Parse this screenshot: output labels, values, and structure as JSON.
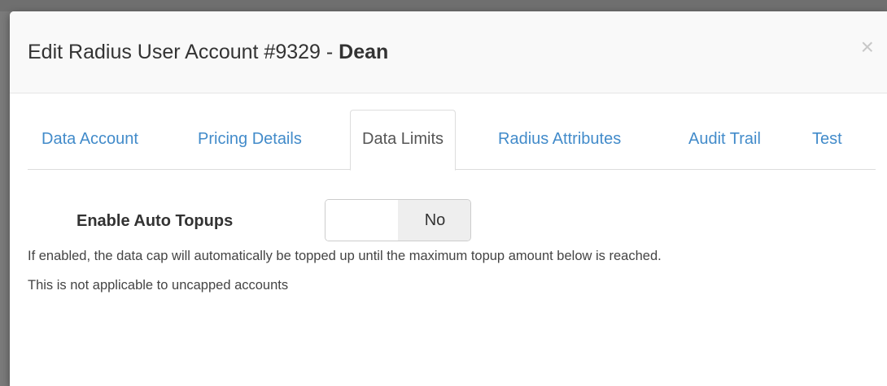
{
  "modal": {
    "title_prefix": "Edit Radius User Account #9329 - ",
    "title_name": "Dean",
    "close_glyph": "×"
  },
  "tabs": [
    {
      "label": "Data Account",
      "active": false
    },
    {
      "label": "Pricing Details",
      "active": false
    },
    {
      "label": "Data Limits",
      "active": true
    },
    {
      "label": "Radius Attributes",
      "active": false
    },
    {
      "label": "Audit Trail",
      "active": false
    },
    {
      "label": "Test",
      "active": false
    }
  ],
  "form": {
    "auto_topups_label": "Enable Auto Topups",
    "auto_topups_value": "No",
    "help_line_1": "If enabled, the data cap will automatically be topped up until the maximum topup amount below is reached.",
    "help_line_2": "This is not applicable to uncapped accounts"
  },
  "colors": {
    "link": "#428bca",
    "active_tab_text": "#555555",
    "toggle_active_bg": "#eeeeee"
  }
}
